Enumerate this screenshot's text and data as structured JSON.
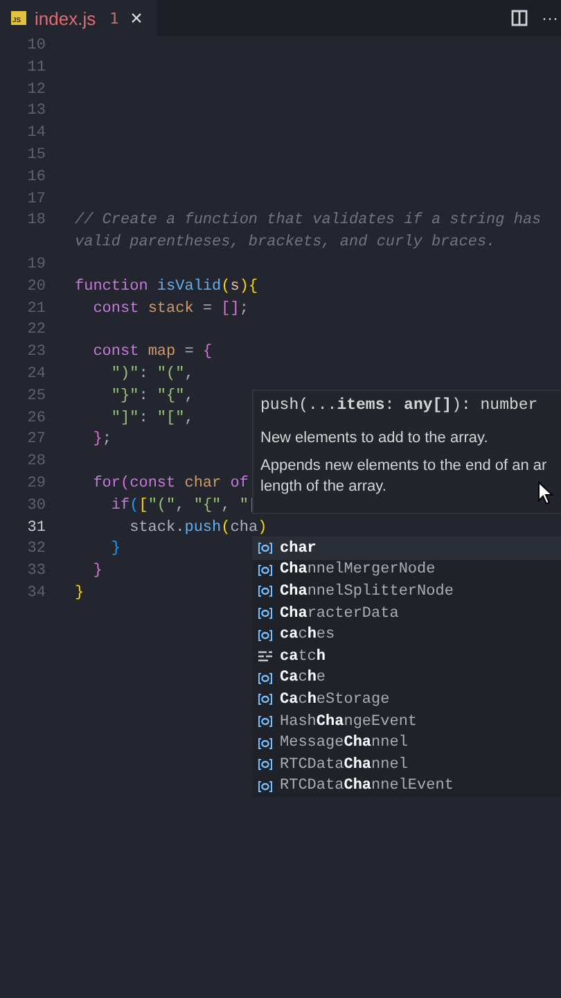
{
  "tab": {
    "icon_label": "JS",
    "title": "index.js",
    "problems": "1",
    "close": "×",
    "error": true
  },
  "toolbar": {
    "more": "···"
  },
  "lines": [
    {
      "number": "10",
      "current": false
    },
    {
      "number": "11",
      "current": false
    },
    {
      "number": "12",
      "current": false
    },
    {
      "number": "13",
      "current": false
    },
    {
      "number": "14",
      "current": false
    },
    {
      "number": "15",
      "current": false
    },
    {
      "number": "16",
      "current": false
    },
    {
      "number": "17",
      "current": false
    },
    {
      "number": "18",
      "current": false,
      "tokens": [
        {
          "t": "// Create a function that validates if a string has valid parentheses, brackets, and curly braces.",
          "kind": "comment"
        }
      ]
    },
    {
      "number": "19",
      "current": false
    },
    {
      "number": "20",
      "current": false,
      "tokens": [
        {
          "t": "function ",
          "kind": "keyword"
        },
        {
          "t": "isValid",
          "kind": "function"
        },
        {
          "t": "(",
          "kind": "bracket1"
        },
        {
          "t": "s",
          "kind": "param"
        },
        {
          "t": "){",
          "kind": "bracket1"
        }
      ]
    },
    {
      "number": "21",
      "current": false,
      "tokens": [
        {
          "t": "  const ",
          "kind": "keyword"
        },
        {
          "t": "stack",
          "kind": "variable"
        },
        {
          "t": " = ",
          "kind": "punct"
        },
        {
          "t": "[]",
          "kind": "bracket2"
        },
        {
          "t": ";",
          "kind": "punct"
        }
      ]
    },
    {
      "number": "22",
      "current": false
    },
    {
      "number": "23",
      "current": false,
      "tokens": [
        {
          "t": "  const ",
          "kind": "keyword"
        },
        {
          "t": "map",
          "kind": "variable"
        },
        {
          "t": " = ",
          "kind": "punct"
        },
        {
          "t": "{",
          "kind": "bracket2"
        }
      ]
    },
    {
      "number": "24",
      "current": false,
      "tokens": [
        {
          "t": "    \")\"",
          "kind": "string"
        },
        {
          "t": ": ",
          "kind": "punct"
        },
        {
          "t": "\"(\"",
          "kind": "string"
        },
        {
          "t": ",",
          "kind": "punct"
        }
      ]
    },
    {
      "number": "25",
      "current": false,
      "tokens": [
        {
          "t": "    \"}\"",
          "kind": "string"
        },
        {
          "t": ": ",
          "kind": "punct"
        },
        {
          "t": "\"{\"",
          "kind": "string"
        },
        {
          "t": ",",
          "kind": "punct"
        }
      ]
    },
    {
      "number": "26",
      "current": false,
      "tokens": [
        {
          "t": "    \"]\"",
          "kind": "string"
        },
        {
          "t": ": ",
          "kind": "punct"
        },
        {
          "t": "\"[\"",
          "kind": "string"
        },
        {
          "t": ",",
          "kind": "punct"
        }
      ]
    },
    {
      "number": "27",
      "current": false,
      "tokens": [
        {
          "t": "  }",
          "kind": "bracket2"
        },
        {
          "t": ";",
          "kind": "punct"
        }
      ]
    },
    {
      "number": "28",
      "current": false
    },
    {
      "number": "29",
      "current": false,
      "tokens": [
        {
          "t": "  for",
          "kind": "keyword"
        },
        {
          "t": "(",
          "kind": "bracket2"
        },
        {
          "t": "const ",
          "kind": "keyword"
        },
        {
          "t": "char ",
          "kind": "variable"
        },
        {
          "t": "of",
          "kind": "keyword"
        }
      ]
    },
    {
      "number": "30",
      "current": false,
      "tokens": [
        {
          "t": "    if",
          "kind": "keyword"
        },
        {
          "t": "(",
          "kind": "bracket3"
        },
        {
          "t": "[",
          "kind": "bracket1"
        },
        {
          "t": "\"(\"",
          "kind": "string"
        },
        {
          "t": ", ",
          "kind": "punct"
        },
        {
          "t": "\"{\"",
          "kind": "string"
        },
        {
          "t": ", ",
          "kind": "punct"
        },
        {
          "t": "\"[",
          "kind": "string"
        }
      ]
    },
    {
      "number": "31",
      "current": true,
      "tokens": [
        {
          "t": "      stack",
          "kind": "plain"
        },
        {
          "t": ".",
          "kind": "punct"
        },
        {
          "t": "push",
          "kind": "function"
        },
        {
          "t": "(",
          "kind": "bracket1"
        },
        {
          "t": "cha",
          "kind": "plain"
        },
        {
          "t": ")",
          "kind": "bracket1"
        }
      ]
    },
    {
      "number": "32",
      "current": false,
      "tokens": [
        {
          "t": "    }",
          "kind": "bracket3"
        }
      ]
    },
    {
      "number": "33",
      "current": false,
      "tokens": [
        {
          "t": "  }",
          "kind": "bracket2"
        }
      ]
    },
    {
      "number": "34",
      "current": false,
      "tokens": [
        {
          "t": "}",
          "kind": "bracket1"
        }
      ]
    }
  ],
  "hover": {
    "signature": "push(...**items**: **any[]**): number",
    "param_doc": "New elements to add to the array.",
    "doc_lines": [
      "Appends new elements to the end of an ar",
      "length of the array."
    ]
  },
  "suggestions": [
    {
      "label": "**char**",
      "kind": "variable",
      "selected": true
    },
    {
      "label": "**Cha**nnelMergerNode",
      "kind": "variable",
      "selected": false
    },
    {
      "label": "**Cha**nnelSplitterNode",
      "kind": "variable",
      "selected": false
    },
    {
      "label": "**Cha**racterData",
      "kind": "variable",
      "selected": false
    },
    {
      "label": "**ca**c**h**es",
      "kind": "variable",
      "selected": false
    },
    {
      "label": "**ca**tc**h**",
      "kind": "keyword",
      "selected": false
    },
    {
      "label": "**Ca**c**h**e",
      "kind": "variable",
      "selected": false
    },
    {
      "label": "**Ca**c**h**eStorage",
      "kind": "variable",
      "selected": false
    },
    {
      "label": "Hash**Cha**ngeEvent",
      "kind": "variable",
      "selected": false
    },
    {
      "label": "Message**Cha**nnel",
      "kind": "variable",
      "selected": false
    },
    {
      "label": "RTCData**Cha**nnel",
      "kind": "variable",
      "selected": false
    },
    {
      "label": "RTCData**Cha**nnelEvent",
      "kind": "variable",
      "selected": false
    }
  ]
}
